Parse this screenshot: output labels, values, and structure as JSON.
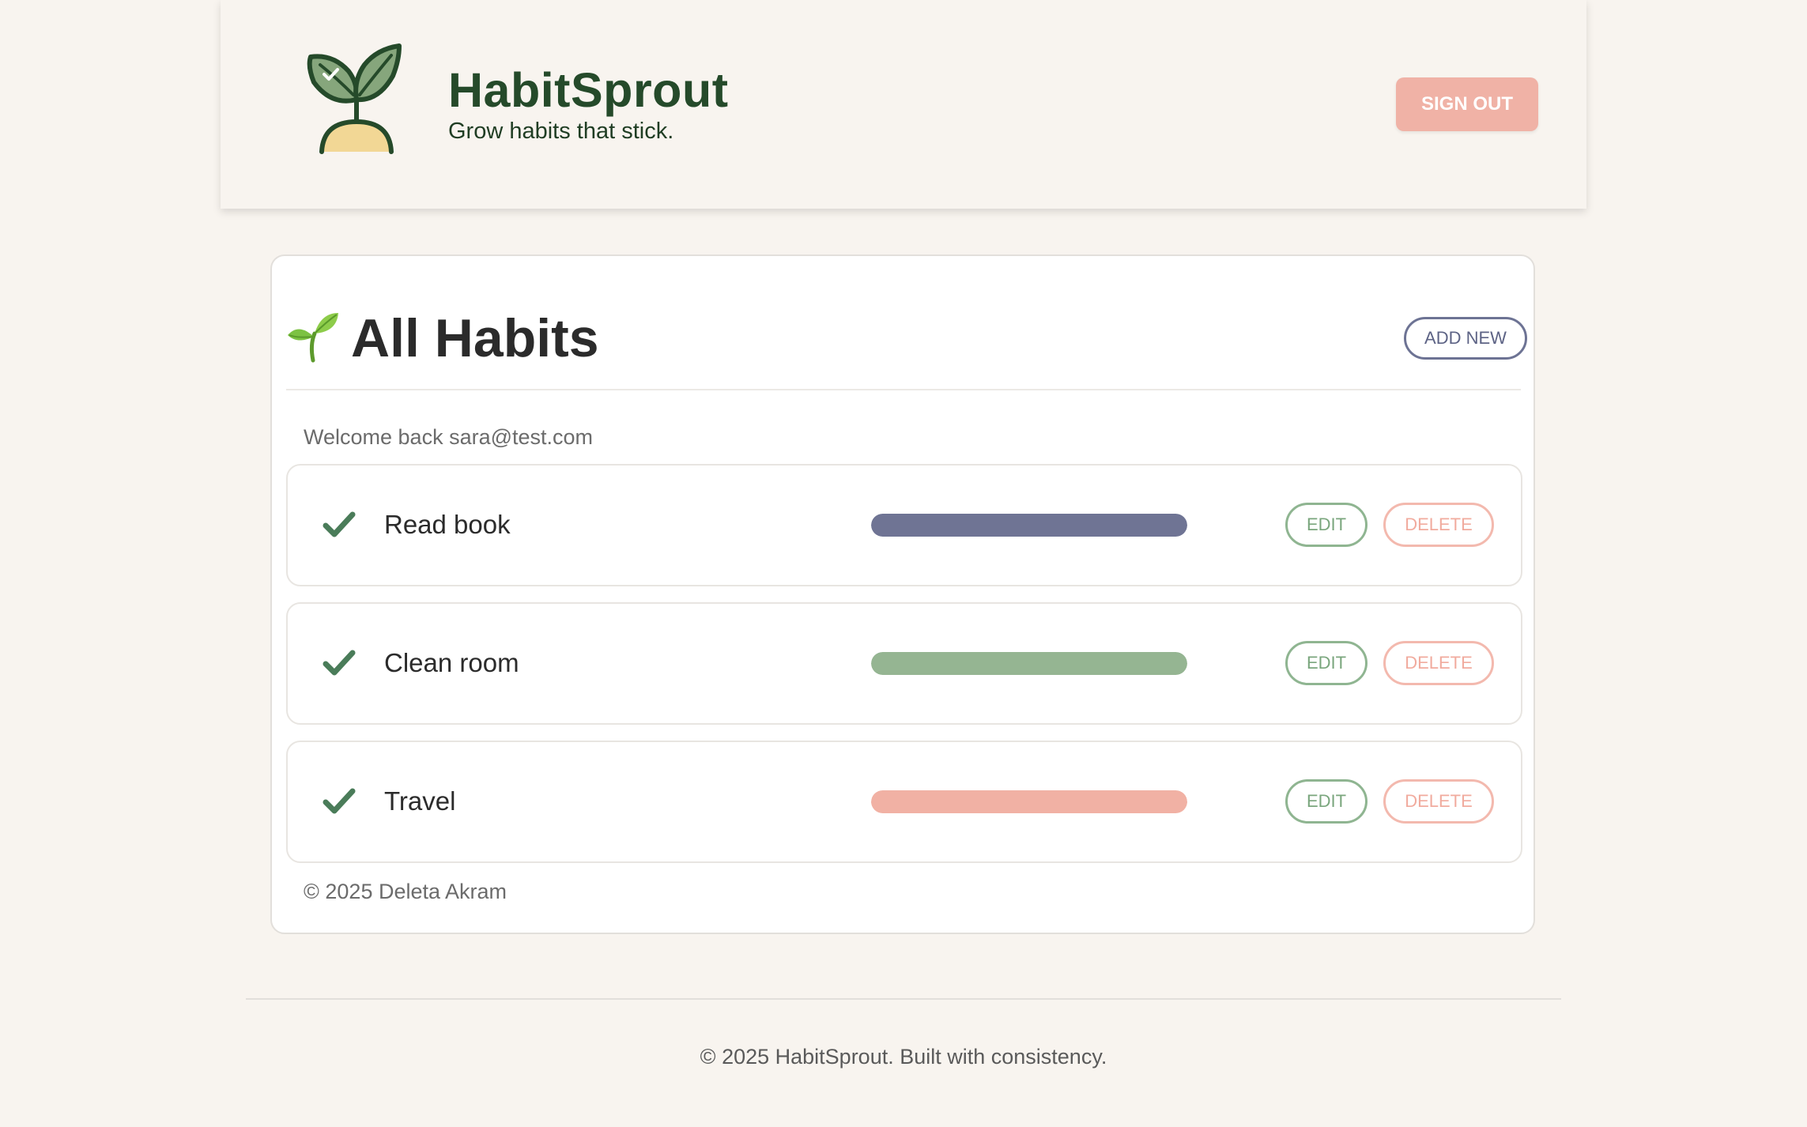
{
  "header": {
    "brand_name": "HabitSprout",
    "tagline": "Grow habits that stick.",
    "signout_label": "SIGN OUT",
    "logo_icon": "sprout-logo-icon"
  },
  "card": {
    "title": "All Habits",
    "title_icon": "seedling-emoji-icon",
    "add_new_label": "ADD NEW",
    "welcome_text": "Welcome back sara@test.com",
    "footer_text": "© 2025 Deleta Akram"
  },
  "habits": [
    {
      "name": "Read book",
      "check_icon": "checkmark-icon",
      "color": "#6f7494",
      "edit_label": "EDIT",
      "delete_label": "DELETE"
    },
    {
      "name": "Clean room",
      "check_icon": "checkmark-icon",
      "color": "#95b592",
      "edit_label": "EDIT",
      "delete_label": "DELETE"
    },
    {
      "name": "Travel",
      "check_icon": "checkmark-icon",
      "color": "#f1b1a4",
      "edit_label": "EDIT",
      "delete_label": "DELETE"
    }
  ],
  "page_footer": {
    "text": "© 2025 HabitSprout. Built with consistency."
  },
  "colors": {
    "background": "#f8f4ef",
    "brand_green": "#254a2a",
    "signout_bg": "#f0b2a6",
    "add_new_border": "#6d7394",
    "edit_green": "#8fb591",
    "delete_pink": "#f3b9ae",
    "check_green": "#4a7c59"
  }
}
